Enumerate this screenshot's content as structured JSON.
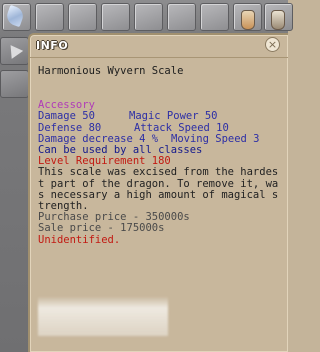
{
  "tooltip": {
    "header": "INFO",
    "close_symbol": "×",
    "item_name": "Harmonious Wyvern Scale",
    "category": "Accessory",
    "stats": [
      {
        "left": "Damage 50",
        "right": "Magic Power 50"
      },
      {
        "left": "Defense 80",
        "right": "Attack Speed 10"
      },
      {
        "left": "Damage decrease 4 %",
        "right": "Moving Speed 3"
      }
    ],
    "class_restriction": "Can be used by all classes",
    "level_requirement": "Level Requirement 180",
    "description": "This scale was excised from the hardest part of the dragon. To remove it, was necessary a high amount of magical strength.",
    "purchase_price": "Purchase price - 350000s",
    "sale_price": "Sale price - 175000s",
    "status": "Unidentified."
  },
  "colors": {
    "panel_bg": "#c8b79c",
    "category": "#b03cb8",
    "stats": "#2d2fa6",
    "class_line": "#141a8c",
    "warning": "#c21a12"
  },
  "icons": [
    "close-icon",
    "gem-icon",
    "arrow-icon",
    "potion-icon"
  ]
}
